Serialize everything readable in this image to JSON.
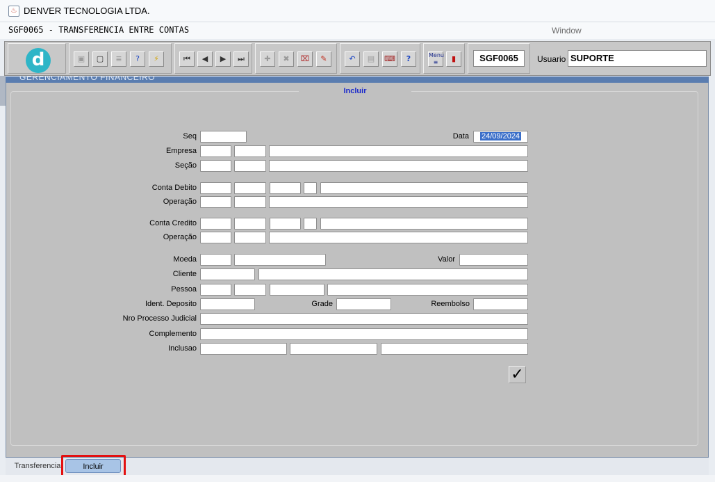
{
  "window": {
    "app_title": "DENVER TECNOLOGIA LTDA.",
    "form_title": "SGF0065 - TRANSFERENCIA ENTRE CONTAS",
    "window_menu": "Window"
  },
  "toolbar": {
    "logo_letter": "d",
    "form_code": "SGF0065",
    "user_label": "Usuario",
    "user_value": "SUPORTE",
    "icons": [
      "save-icon",
      "print-preview-icon",
      "print-icon",
      "query-help-icon",
      "execute-query-icon",
      "first-record-icon",
      "previous-record-icon",
      "next-record-icon",
      "last-record-icon",
      "insert-record-icon",
      "delete-record-icon",
      "clear-form-icon",
      "edit-icon",
      "undo-icon",
      "list-values-icon",
      "key-help-icon",
      "help-icon",
      "menu-icon",
      "exit-icon"
    ]
  },
  "frame": {
    "header_text": "GERENCIAMENTO FINANCEIRO",
    "legend": "Incluir"
  },
  "form": {
    "seq": "Seq",
    "data": "Data",
    "data_value": "24/09/2024",
    "empresa": "Empresa",
    "secao": "Seção",
    "conta_debito": "Conta Debito",
    "operacao_1": "Operação",
    "conta_credito": "Conta Credito",
    "operacao_2": "Operação",
    "moeda": "Moeda",
    "valor": "Valor",
    "cliente": "Cliente",
    "pessoa": "Pessoa",
    "ident_deposito": "Ident. Deposito",
    "grade": "Grade",
    "reembolso": "Reembolso",
    "nro_processo": "Nro Processo Judicial",
    "complemento": "Complemento",
    "inclusao": "Inclusao"
  },
  "tabs": [
    {
      "label": "Transferencia"
    },
    {
      "label": "Incluir"
    }
  ]
}
